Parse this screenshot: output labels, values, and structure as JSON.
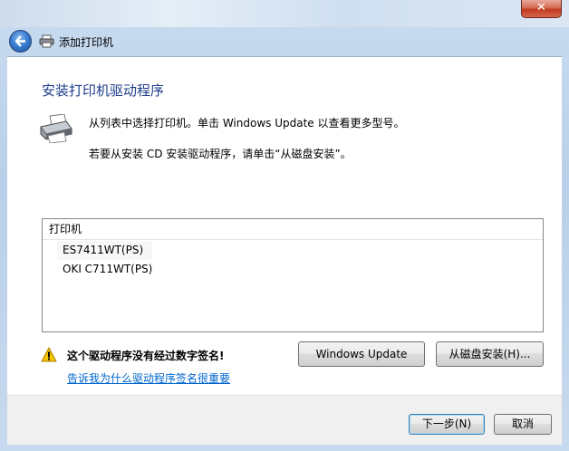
{
  "window": {
    "title": "添加打印机",
    "close_glyph": "✕"
  },
  "page": {
    "heading": "安装打印机驱动程序",
    "description_line1": "从列表中选择打印机。单击 Windows Update 以查看更多型号。",
    "description_line2": "若要从安装 CD 安装驱动程序，请单击“从磁盘安装”。"
  },
  "printer_list": {
    "header": "打印机",
    "items": [
      "ES7411WT(PS)",
      "OKI C711WT(PS)"
    ],
    "selected_index": 0
  },
  "warning": {
    "text": "这个驱动程序没有经过数字签名!",
    "link": "告诉我为什么驱动程序签名很重要"
  },
  "buttons": {
    "windows_update": "Windows Update",
    "have_disk": "从磁盘安装(H)...",
    "next": "下一步(N)",
    "cancel": "取消"
  },
  "colors": {
    "heading": "#1e3d8a",
    "link": "#0066cc",
    "close_button": "#c2391f"
  },
  "icons": [
    "back-arrow-icon",
    "printer-icon",
    "warning-icon",
    "close-icon"
  ]
}
